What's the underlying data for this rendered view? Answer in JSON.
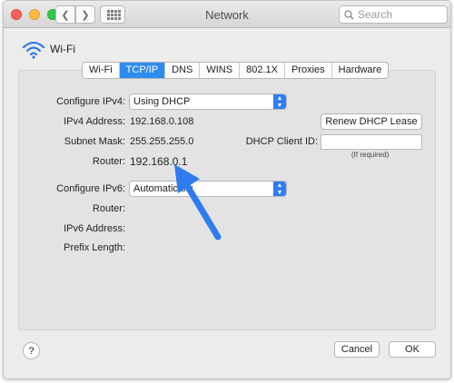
{
  "window": {
    "title": "Network"
  },
  "toolbar": {
    "search_placeholder": "Search"
  },
  "header": {
    "service": "Wi-Fi"
  },
  "tabs": [
    {
      "label": "Wi-Fi"
    },
    {
      "label": "TCP/IP"
    },
    {
      "label": "DNS"
    },
    {
      "label": "WINS"
    },
    {
      "label": "802.1X"
    },
    {
      "label": "Proxies"
    },
    {
      "label": "Hardware"
    }
  ],
  "ipv4": {
    "configure_label": "Configure IPv4:",
    "configure_value": "Using DHCP",
    "address_label": "IPv4 Address:",
    "address_value": "192.168.0.108",
    "subnet_label": "Subnet Mask:",
    "subnet_value": "255.255.255.0",
    "router_label": "Router:",
    "router_value": "192.168.0.1",
    "renew_button": "Renew DHCP Lease",
    "client_id_label": "DHCP Client ID:",
    "client_id_value": "",
    "client_id_hint": "(If required)"
  },
  "ipv6": {
    "configure_label": "Configure IPv6:",
    "configure_value": "Automatically",
    "router_label": "Router:",
    "address_label": "IPv6 Address:",
    "prefix_label": "Prefix Length:"
  },
  "footer": {
    "help": "?",
    "cancel": "Cancel",
    "ok": "OK"
  },
  "colors": {
    "accent": "#2d8cf0",
    "arrow": "#2f7cf0"
  }
}
